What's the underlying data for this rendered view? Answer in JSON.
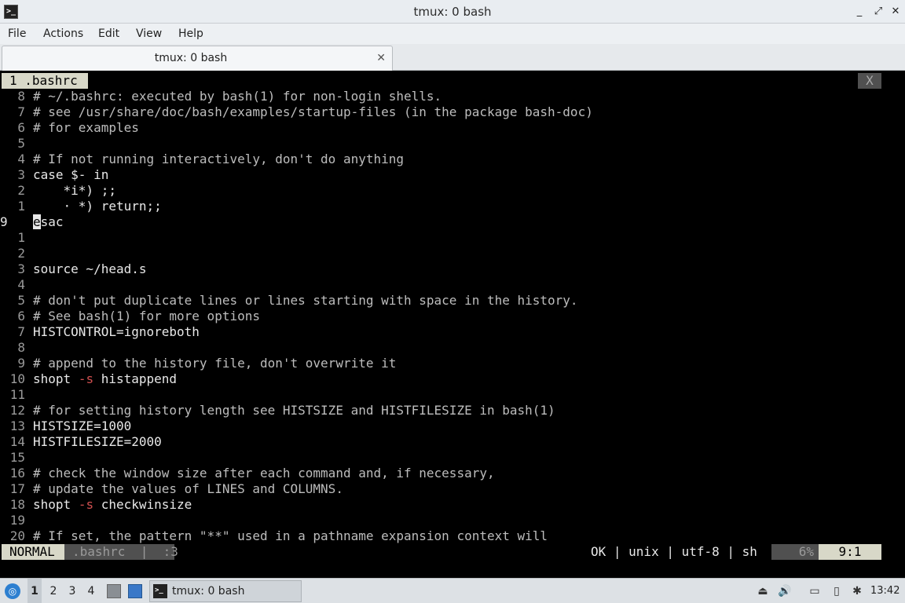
{
  "window": {
    "title": "tmux: 0 bash",
    "app_icon_glyph": ">_",
    "controls": {
      "minimize": "_",
      "maximize": "□",
      "restore": "⤢",
      "close": "✕"
    }
  },
  "menu": [
    "File",
    "Actions",
    "Edit",
    "View",
    "Help"
  ],
  "tab": {
    "title": "tmux: 0 bash",
    "close": "✕"
  },
  "vim": {
    "tabline": {
      "buffer": "1 .bashrc",
      "close": "X"
    },
    "lines": [
      {
        "num": "8",
        "text": "# ~/.bashrc: executed by bash(1) for non-login shells."
      },
      {
        "num": "7",
        "text": "# see /usr/share/doc/bash/examples/startup-files (in the package bash-doc)"
      },
      {
        "num": "6",
        "text": "# for examples"
      },
      {
        "num": "5",
        "text": ""
      },
      {
        "num": "4",
        "text": "# If not running interactively, don't do anything"
      },
      {
        "num": "3",
        "text": "case $- in"
      },
      {
        "num": "2",
        "text": "    *i*) ;;"
      },
      {
        "num": "1",
        "text": "    · *) return;;"
      },
      {
        "num": "9",
        "text": "esac",
        "cursor_char": "e",
        "rest": "sac"
      },
      {
        "num": "1",
        "text": ""
      },
      {
        "num": "2",
        "text": ""
      },
      {
        "num": "3",
        "text": "source ~/head.s"
      },
      {
        "num": "4",
        "text": ""
      },
      {
        "num": "5",
        "text": "# don't put duplicate lines or lines starting with space in the history."
      },
      {
        "num": "6",
        "text": "# See bash(1) for more options"
      },
      {
        "num": "7",
        "text": "HISTCONTROL=ignoreboth"
      },
      {
        "num": "8",
        "text": ""
      },
      {
        "num": "9",
        "text": "# append to the history file, don't overwrite it"
      },
      {
        "num": "10",
        "text": "shopt",
        "flag": "-s",
        "arg": "histappend"
      },
      {
        "num": "11",
        "text": ""
      },
      {
        "num": "12",
        "text": "# for setting history length see HISTSIZE and HISTFILESIZE in bash(1)"
      },
      {
        "num": "13",
        "text": "HISTSIZE=1000"
      },
      {
        "num": "14",
        "text": "HISTFILESIZE=2000"
      },
      {
        "num": "15",
        "text": ""
      },
      {
        "num": "16",
        "text": "# check the window size after each command and, if necessary,"
      },
      {
        "num": "17",
        "text": "# update the values of LINES and COLUMNS."
      },
      {
        "num": "18",
        "text": "shopt",
        "flag": "-s",
        "arg": "checkwinsize"
      },
      {
        "num": "19",
        "text": ""
      },
      {
        "num": "20",
        "text": "# If set, the pattern \"**\" used in a pathname expansion context will"
      }
    ],
    "status": {
      "mode": "NORMAL",
      "file": ".bashrc  |  :3",
      "right": "OK | unix | utf-8 | sh",
      "percent": "6%",
      "position": "9:1"
    }
  },
  "taskbar": {
    "workspaces": [
      "1",
      "2",
      "3",
      "4"
    ],
    "active_workspace": "1",
    "task_label": "tmux: 0 bash",
    "clock": "13:42",
    "tray_icons": [
      "upload-icon",
      "volume-icon",
      "network-icon",
      "clipboard-icon",
      "bluetooth-icon"
    ]
  }
}
